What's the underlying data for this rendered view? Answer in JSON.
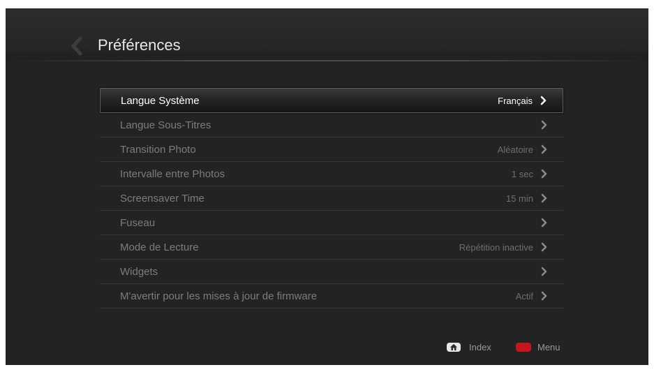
{
  "header": {
    "title": "Préférences",
    "back_icon": "chevron-left-icon"
  },
  "settings": [
    {
      "label": "Langue Système",
      "value": "Français",
      "selected": true
    },
    {
      "label": "Langue Sous-Titres",
      "value": "",
      "selected": false
    },
    {
      "label": "Transition Photo",
      "value": "Aléatoire",
      "selected": false
    },
    {
      "label": "Intervalle entre Photos",
      "value": "1 sec",
      "selected": false
    },
    {
      "label": "Screensaver Time",
      "value": "15 min",
      "selected": false
    },
    {
      "label": "Fuseau",
      "value": "",
      "selected": false
    },
    {
      "label": "Mode de Lecture",
      "value": "Répétition inactive",
      "selected": false
    },
    {
      "label": "Widgets",
      "value": "",
      "selected": false
    },
    {
      "label": "M'avertir pour les mises à jour de firmware",
      "value": "Actif",
      "selected": false
    }
  ],
  "footer": {
    "index_label": "Index",
    "index_icon": "home-icon",
    "menu_label": "Menu",
    "menu_key_color": "#c4161c"
  },
  "colors": {
    "background": "#232323",
    "selected_text": "#ffffff",
    "inactive_text": "#7c7c7c"
  }
}
